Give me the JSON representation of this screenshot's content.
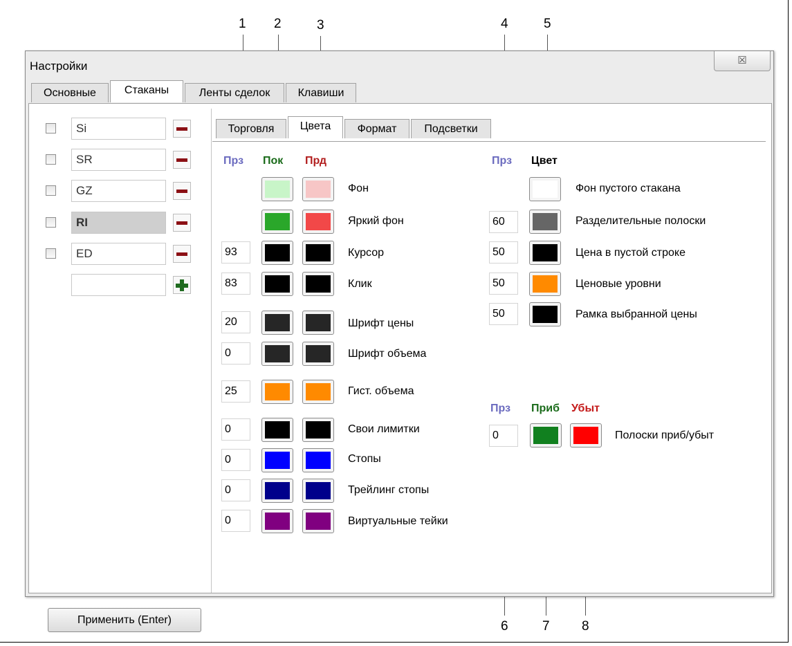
{
  "callouts": [
    "1",
    "2",
    "3",
    "4",
    "5",
    "6",
    "7",
    "8"
  ],
  "window": {
    "title": "Настройки",
    "close_glyph": "☒",
    "tabs": [
      "Основные",
      "Стаканы",
      "Ленты сделок",
      "Клавиши"
    ],
    "active_tab": "Стаканы"
  },
  "instruments": [
    {
      "name": "Si",
      "checked": false,
      "selected": false
    },
    {
      "name": "SR",
      "checked": false,
      "selected": false
    },
    {
      "name": "GZ",
      "checked": false,
      "selected": false
    },
    {
      "name": "RI",
      "checked": false,
      "selected": true
    },
    {
      "name": "ED",
      "checked": false,
      "selected": false
    }
  ],
  "new_instrument": {
    "value": ""
  },
  "apply_label": "Применить (Enter)",
  "inner_tabs": [
    "Торговля",
    "Цвета",
    "Формат",
    "Подсветки"
  ],
  "active_inner_tab": "Цвета",
  "left_headers": {
    "prz": "Прз",
    "buy": "Пок",
    "sell": "Прд"
  },
  "header_colors": {
    "prz": "#6b6bbf",
    "buy": "#1a6b1a",
    "sell": "#b21e1e",
    "color": "#000000",
    "profit": "#1a6b1a",
    "loss": "#c41a1a"
  },
  "left_rows": [
    {
      "prz": "",
      "buy": "#c8f5c8",
      "sell": "#f7c6c6",
      "label": "Фон"
    },
    {
      "prz": "",
      "buy": "#2aa72a",
      "sell": "#f24848",
      "label": "Яркий фон"
    },
    {
      "prz": "93",
      "buy": "#000000",
      "sell": "#000000",
      "label": "Курсор"
    },
    {
      "prz": "83",
      "buy": "#000000",
      "sell": "#000000",
      "label": "Клик"
    },
    {
      "prz": "20",
      "buy": "#262626",
      "sell": "#262626",
      "label": "Шрифт цены"
    },
    {
      "prz": "0",
      "buy": "#262626",
      "sell": "#262626",
      "label": "Шрифт объема"
    },
    {
      "prz": "25",
      "buy": "#ff8a00",
      "sell": "#ff8a00",
      "label": "Гист. объема"
    },
    {
      "prz": "0",
      "buy": "#000000",
      "sell": "#000000",
      "label": "Свои лимитки"
    },
    {
      "prz": "0",
      "buy": "#0000ff",
      "sell": "#0000ff",
      "label": "Стопы"
    },
    {
      "prz": "0",
      "buy": "#00008b",
      "sell": "#00008b",
      "label": "Трейлинг стопы"
    },
    {
      "prz": "0",
      "buy": "#800080",
      "sell": "#800080",
      "label": "Виртуальные тейки"
    }
  ],
  "right_headers": {
    "prz": "Прз",
    "color": "Цвет"
  },
  "right_rows": [
    {
      "prz": "",
      "color": "#ffffff",
      "label": "Фон пустого стакана"
    },
    {
      "prz": "60",
      "color": "#666666",
      "label": "Разделительные полоски"
    },
    {
      "prz": "50",
      "color": "#000000",
      "label": "Цена в пустой строке"
    },
    {
      "prz": "50",
      "color": "#ff8a00",
      "label": "Ценовые уровни"
    },
    {
      "prz": "50",
      "color": "#000000",
      "label": "Рамка выбранной цены"
    }
  ],
  "pl_headers": {
    "prz": "Прз",
    "profit": "Приб",
    "loss": "Убыт"
  },
  "pl_row": {
    "prz": "0",
    "profit": "#11801f",
    "loss": "#ff0000",
    "label": "Полоски приб/убыт"
  }
}
